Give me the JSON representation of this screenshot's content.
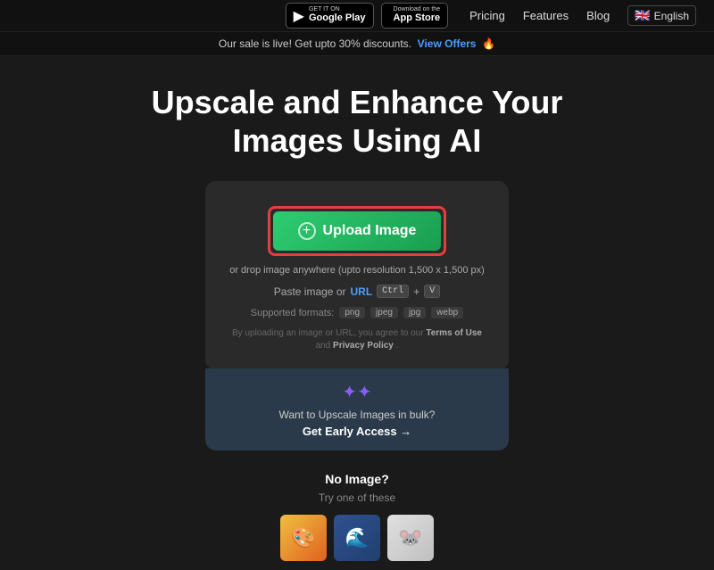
{
  "nav": {
    "google_play_sub": "GET IT ON",
    "google_play_main": "Google Play",
    "app_store_sub": "Download on the",
    "app_store_main": "App Store",
    "pricing": "Pricing",
    "features": "Features",
    "blog": "Blog",
    "language": "English"
  },
  "announcement": {
    "text": "Our sale is live! Get upto 30% discounts.",
    "link_text": "View Offers",
    "emoji": "🔥"
  },
  "hero": {
    "title_line1": "Upscale and Enhance Your",
    "title_line2": "Images Using AI"
  },
  "upload": {
    "button_label": "Upload Image",
    "drop_text": "or drop image anywhere (upto resolution 1,500 x 1,500 px)",
    "paste_text": "Paste image or",
    "url_label": "URL",
    "ctrl_label": "Ctrl",
    "plus": "+",
    "v_label": "V",
    "formats_label": "Supported formats:",
    "formats": [
      "png",
      "jpeg",
      "jpg",
      "webp"
    ],
    "terms_text": "By uploading an image or URL, you agree to our",
    "terms_link": "Terms of Use",
    "and": "and",
    "privacy_link": "Privacy Policy",
    "terms_end": "."
  },
  "bulk": {
    "text": "Want to Upscale Images in bulk?",
    "link": "Get Early Access →"
  },
  "no_image": {
    "title": "No Image?",
    "subtitle": "Try one of these"
  },
  "samples": [
    {
      "emoji": "🎨",
      "bg": "sample-img-1"
    },
    {
      "emoji": "🌊",
      "bg": "sample-img-2"
    },
    {
      "emoji": "🐭",
      "bg": "sample-img-3"
    }
  ]
}
